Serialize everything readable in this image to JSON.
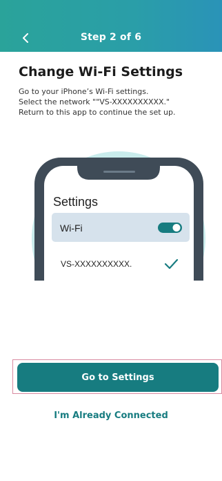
{
  "header": {
    "title": "Step 2 of 6",
    "back_icon": "chevron-left-icon"
  },
  "main": {
    "title": "Change Wi-Fi Settings",
    "instructions": [
      "Go to your iPhone’s Wi-Fi settings.",
      "Select the network \"\"VS-XXXXXXXXXX.\"",
      "Return to this app to continue the set up."
    ]
  },
  "illustration": {
    "screen_title": "Settings",
    "wifi_label": "Wi-Fi",
    "wifi_toggle_on": true,
    "network_name": "VS-XXXXXXXXXX."
  },
  "actions": {
    "primary_label": "Go to Settings",
    "secondary_label": "I'm Already Connected"
  },
  "colors": {
    "header_gradient_start": "#2aa39a",
    "header_gradient_end": "#2a93b8",
    "primary": "#177c80",
    "illustration_circle": "#c9ecec",
    "phone_frame": "#3f4b57",
    "wifi_row_bg": "#d6e2ec"
  }
}
